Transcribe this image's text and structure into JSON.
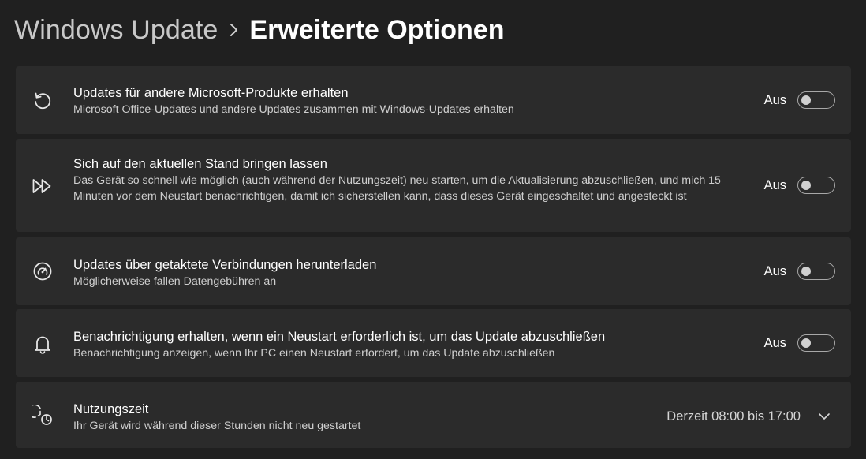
{
  "breadcrumb": {
    "parent": "Windows Update",
    "current": "Erweiterte Optionen"
  },
  "settings": [
    {
      "icon": "refresh-icon",
      "title": "Updates für andere Microsoft-Produkte erhalten",
      "description": "Microsoft Office-Updates und andere Updates zusammen mit Windows-Updates erhalten",
      "state": "Aus",
      "enabled": false
    },
    {
      "icon": "fast-forward-icon",
      "title": "Sich auf den aktuellen Stand bringen lassen",
      "description": "Das Gerät so schnell wie möglich (auch während der Nutzungszeit) neu starten, um die Aktualisierung abzuschließen, und mich 15 Minuten vor dem Neustart benachrichtigen, damit ich sicherstellen kann, dass dieses Gerät eingeschaltet und angesteckt ist",
      "state": "Aus",
      "enabled": false
    },
    {
      "icon": "speedometer-icon",
      "title": "Updates über getaktete Verbindungen herunterladen",
      "description": "Möglicherweise fallen Datengebühren an",
      "state": "Aus",
      "enabled": false
    },
    {
      "icon": "bell-icon",
      "title": "Benachrichtigung erhalten, wenn ein Neustart erforderlich ist, um das Update abzuschließen",
      "description": "Benachrichtigung anzeigen, wenn Ihr PC einen Neustart erfordert, um das Update abzuschließen",
      "state": "Aus",
      "enabled": false
    }
  ],
  "active_hours": {
    "icon": "active-hours-clock-icon",
    "title": "Nutzungszeit",
    "description": "Ihr Gerät wird während dieser Stunden nicht neu gestartet",
    "value": "Derzeit 08:00 bis 17:00"
  },
  "colors": {
    "background": "#202020",
    "card": "#2b2b2b",
    "text": "#ffffff",
    "secondary_text": "#cfcfcf"
  }
}
